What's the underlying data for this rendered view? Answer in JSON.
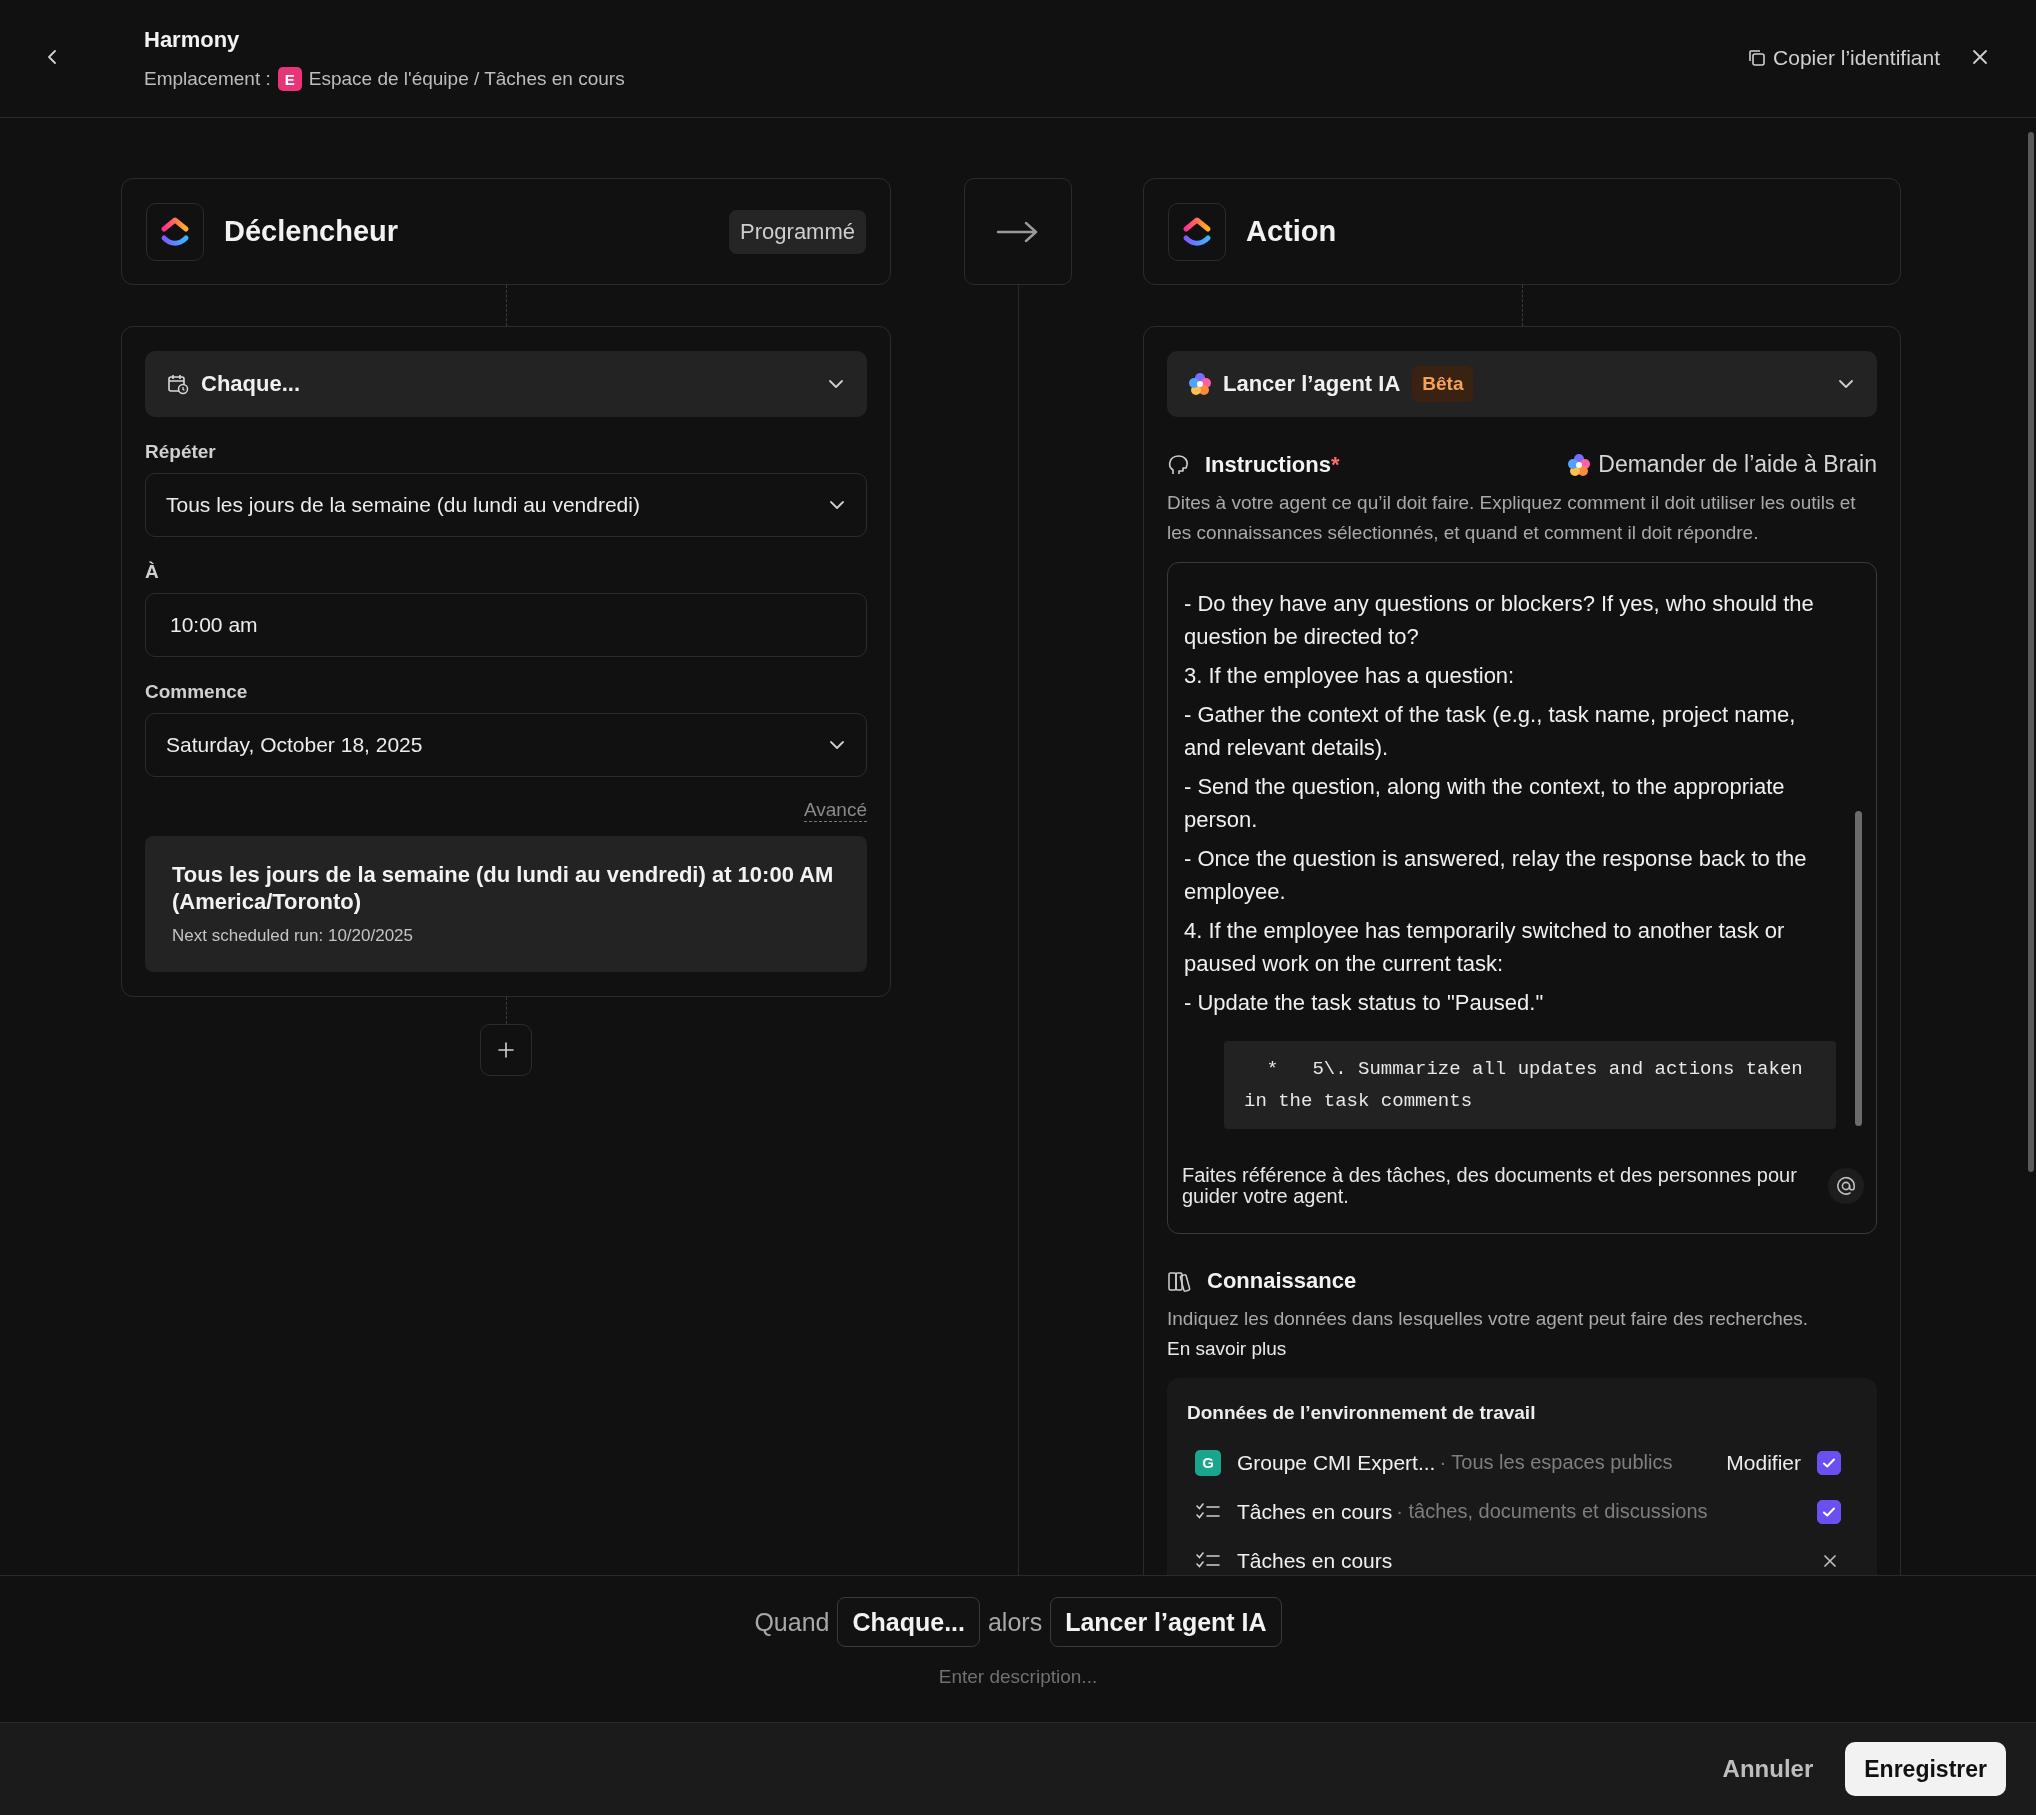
{
  "header": {
    "title": "Harmony",
    "location_label": "Emplacement :",
    "space_badge": "E",
    "location_path": "Espace de l'équipe / Tâches en cours",
    "copy_button": "Copier l’identifiant"
  },
  "trigger": {
    "title": "Déclencheur",
    "badge": "Programmé",
    "schedule_type": "Chaque...",
    "fields": [
      {
        "label": "Répéter",
        "value": "Tous les jours de la semaine (du lundi au vendredi)",
        "kind": "select"
      },
      {
        "label": "À",
        "value": "10:00 am",
        "kind": "input"
      },
      {
        "label": "Commence",
        "value": "Saturday, October 18, 2025",
        "kind": "select"
      }
    ],
    "advanced_link": "Avancé",
    "summary": {
      "title": "Tous les jours de la semaine (du lundi au vendredi) at 10:00 AM (America/Toronto)",
      "next_run": "Next scheduled run: 10/20/2025"
    }
  },
  "action": {
    "title": "Action",
    "type": "Lancer l’agent IA",
    "badge": "Bêta",
    "instructions": {
      "label": "Instructions",
      "required_mark": "*",
      "brain_button": "Demander de l’aide à Brain",
      "description": "Dites à votre agent ce qu’il doit faire. Expliquez comment il doit utiliser les outils et les connaissances sélectionnés, et quand et comment il doit répondre.",
      "paragraphs": [
        "- Do they have any questions or blockers? If yes, who should the question be directed to?",
        "3. If the employee has a question:",
        "- Gather the context of the task (e.g., task name, project name, and relevant details).",
        "- Send the question, along with the context, to the appropriate person.",
        "- Once the question is answered, relay the response back to the employee.",
        "4. If the employee has temporarily switched to another task or paused work on the current task:",
        "- Update the task status to \"Paused.\""
      ],
      "code": "  *   5\\. Summarize all updates and actions taken in the task comments",
      "hint": "Faites référence à des tâches, des documents et des personnes pour guider votre agent."
    },
    "knowledge": {
      "title": "Connaissance",
      "description": "Indiquez les données dans lesquelles votre agent peut faire des recherches.",
      "link": "En savoir plus",
      "group_title": "Données de l’environnement de travail",
      "sources": [
        {
          "kind": "workspace",
          "badge": "G",
          "name": "Groupe CMI Expert...",
          "detail": "· Tous les espaces publics",
          "action": "Modifier",
          "removable": false,
          "checked": true
        },
        {
          "kind": "list",
          "name": "Tâches en cours",
          "detail": "· tâches, documents et discussions",
          "removable": false,
          "checked": true
        },
        {
          "kind": "list",
          "name": "Tâches en cours",
          "removable": true
        }
      ]
    }
  },
  "sentence": {
    "when": "Quand",
    "trigger": "Chaque...",
    "then": "alors",
    "action": "Lancer l’agent IA",
    "description_placeholder": "Enter description..."
  },
  "footer": {
    "cancel": "Annuler",
    "save": "Enregistrer"
  }
}
